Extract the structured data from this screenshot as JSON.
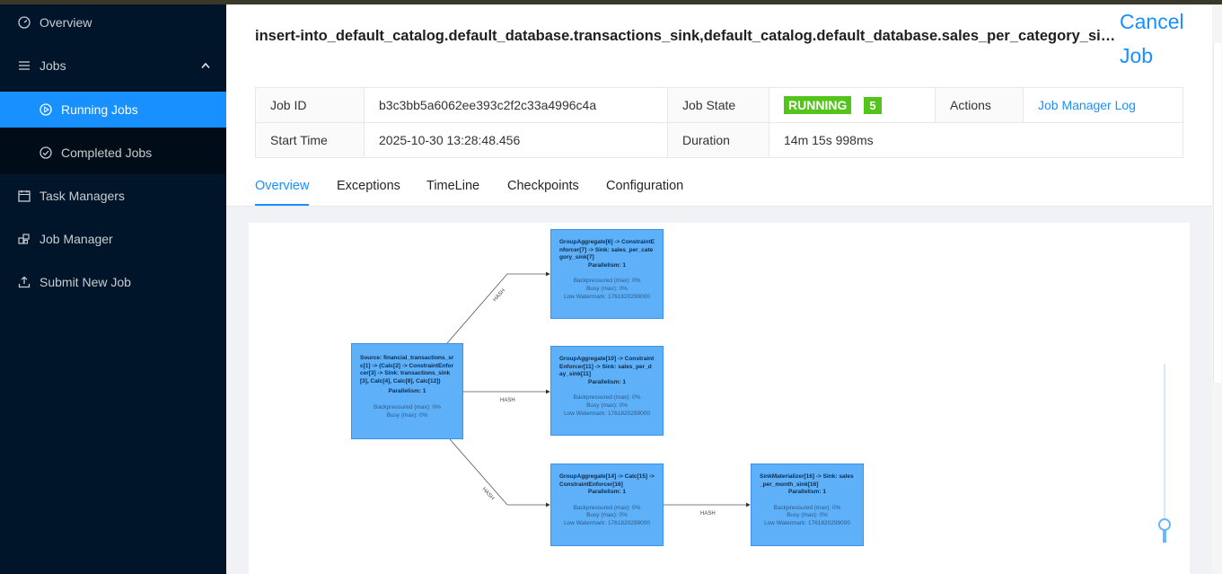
{
  "sidebar": {
    "overview": "Overview",
    "jobs": "Jobs",
    "running_jobs": "Running Jobs",
    "completed_jobs": "Completed Jobs",
    "task_managers": "Task Managers",
    "job_manager": "Job Manager",
    "submit_new_job": "Submit New Job"
  },
  "header": {
    "title": "insert-into_default_catalog.default_database.transactions_sink,default_catalog.default_database.sales_per_category_sink,default_catalog.default_database.sales_per_day_sink,default_catalog.default_database.sales_per_month_sink",
    "cancel_label": "Cancel Job"
  },
  "details": {
    "job_id_label": "Job ID",
    "job_id": "b3c3bb5a6062ee393c2f2c33a4996c4a",
    "job_state_label": "Job State",
    "state": "RUNNING",
    "task_count": "5",
    "actions_label": "Actions",
    "job_manager_log": "Job Manager Log",
    "start_time_label": "Start Time",
    "start_time": "2025-10-30 13:28:48.456",
    "duration_label": "Duration",
    "duration": "14m 15s 998ms"
  },
  "tabs": [
    "Overview",
    "Exceptions",
    "TimeLine",
    "Checkpoints",
    "Configuration"
  ],
  "graph": {
    "nodes": [
      {
        "name": "Source: financial_transactions_src[1] -> (Calc[2] -> ConstraintEnforcer[3] -> Sink: transactions_sink[3], Calc[4], Calc[8], Calc[12])",
        "parallelism": "Parallelism: 1",
        "metrics": [
          "Backpressured (max): 0%",
          "Busy (max): 0%"
        ]
      },
      {
        "name": "GroupAggregate[6] -> ConstraintEnforcer[7] -> Sink: sales_per_category_sink[7]",
        "parallelism": "Parallelism: 1",
        "metrics": [
          "Backpressured (max): 0%",
          "Busy (max): 0%",
          "Low Watermark: 1761820299000"
        ]
      },
      {
        "name": "GroupAggregate[10] -> ConstraintEnforcer[11] -> Sink: sales_per_day_sink[11]",
        "parallelism": "Parallelism: 1",
        "metrics": [
          "Backpressured (max): 0%",
          "Busy (max): 0%",
          "Low Watermark: 1761820299000"
        ]
      },
      {
        "name": "GroupAggregate[14] -> Calc[15] -> ConstraintEnforcer[16]",
        "parallelism": "Parallelism: 1",
        "metrics": [
          "Backpressured (max): 0%",
          "Busy (max): 0%",
          "Low Watermark: 1761820299000"
        ]
      },
      {
        "name": "SinkMaterializer[16] -> Sink: sales_per_month_sink[16]",
        "parallelism": "Parallelism: 1",
        "metrics": [
          "Backpressured (max): 0%",
          "Busy (max): 0%",
          "Low Watermark: 1761820299000"
        ]
      }
    ],
    "edge_label": "HASH"
  },
  "colors": {
    "sidebar_bg": "#001529",
    "accent": "#1890ff",
    "running": "#52c41a",
    "node_fill": "#5eb0f9"
  }
}
